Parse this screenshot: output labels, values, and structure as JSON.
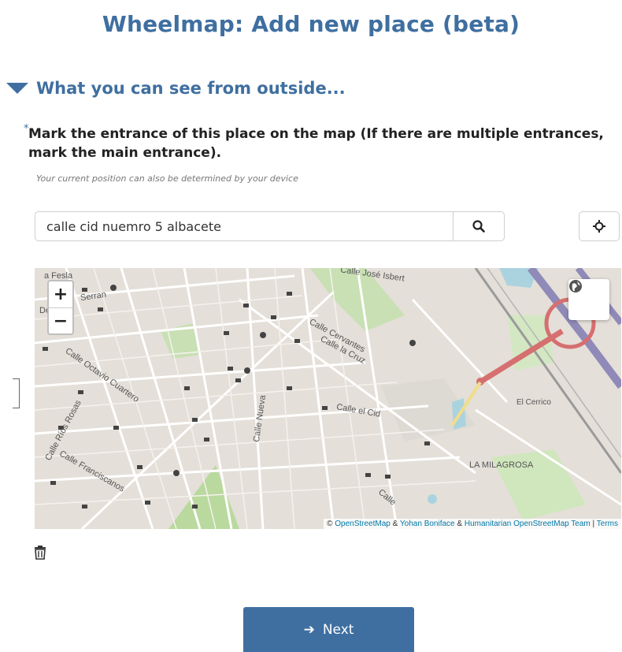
{
  "page": {
    "title": "Wheelmap: Add new place (beta)"
  },
  "section": {
    "title": "What you can see from outside..."
  },
  "field": {
    "required_mark": "*",
    "label": "Mark the entrance of this place on the map (If there are multiple entrances, mark the main entrance).",
    "hint": "Your current position can also be determined by your device"
  },
  "search": {
    "value": "calle cid nuemro 5 albacete",
    "icon": "search-icon"
  },
  "locate": {
    "icon": "crosshair-icon"
  },
  "map": {
    "zoom_in": "+",
    "zoom_out": "−",
    "layer_icon": "globe-icon",
    "attribution_prefix": "©",
    "attribution_osm": "OpenStreetMap",
    "attribution_amp1": "&",
    "attribution_yb": "Yohan Boniface",
    "attribution_amp2": "&",
    "attribution_hot": "Humanitarian OpenStreetMap Team",
    "attribution_sep": "|",
    "attribution_terms": "Terms",
    "labels": {
      "a_fesla": "a Fesla",
      "serran": "Serran",
      "de": "De",
      "jose_isbert": "Calle José Isbert",
      "calle_cervantes": "Calle Cervantes",
      "calle_la_cruz": "Calle la Cruz",
      "calle_octavio_cuartero": "Calle Octavio Cuartero",
      "calle_rios_rosas": "Calle Ríos Rosas",
      "calle_nueva": "Calle Nueva",
      "calle_el_cid": "Calle el Cid",
      "el_cerrico": "El Cerrico",
      "la_milagrosa": "LA MILAGROSA",
      "calle_franciscanos": "Calle Franciscanos",
      "calle": "Calle"
    }
  },
  "actions": {
    "delete_icon": "trash-icon",
    "next_label": "Next",
    "next_icon": "arrow-right-icon"
  },
  "colors": {
    "primary": "#3f6fa0",
    "map_bg": "#e4dfd8",
    "park": "#c8e0b4",
    "highway": "#d66f6f",
    "motorway": "#8f8ab8"
  }
}
